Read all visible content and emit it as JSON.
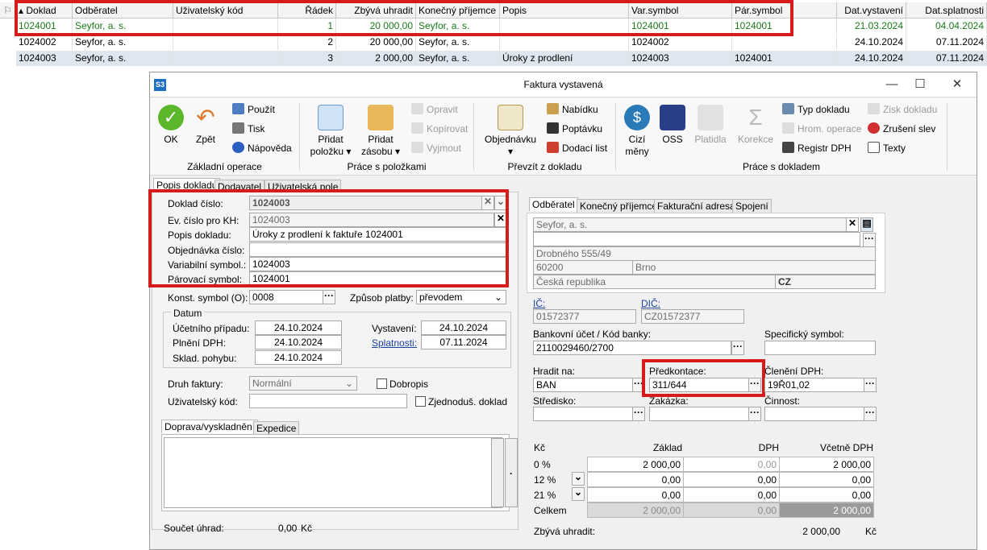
{
  "grid": {
    "columns": [
      "Doklad",
      "Odběratel",
      "Uživatelský kód",
      "Řádek",
      "Zbývá uhradit",
      "Konečný příjemce",
      "Popis",
      "Var.symbol",
      "Pár.symbol",
      "Dat.vystavení",
      "Dat.splatnosti"
    ],
    "rows": [
      {
        "doklad": "1024001",
        "odberatel": "Seyfor, a. s.",
        "kod": "",
        "radek": "1",
        "zbyva": "20 000,00",
        "prijemce": "Seyfor, a. s.",
        "popis": "",
        "var": "1024001",
        "par": "1024001",
        "vyst": "21.03.2024",
        "splat": "04.04.2024"
      },
      {
        "doklad": "1024002",
        "odberatel": "Seyfor, a. s.",
        "kod": "",
        "radek": "2",
        "zbyva": "20 000,00",
        "prijemce": "Seyfor, a. s.",
        "popis": "",
        "var": "1024002",
        "par": "",
        "vyst": "24.10.2024",
        "splat": "07.11.2024"
      },
      {
        "doklad": "1024003",
        "odberatel": "Seyfor, a. s.",
        "kod": "",
        "radek": "3",
        "zbyva": "2 000,00",
        "prijemce": "Seyfor, a. s.",
        "popis": "Úroky z prodlení",
        "var": "1024003",
        "par": "1024001",
        "vyst": "24.10.2024",
        "splat": "07.11.2024"
      }
    ]
  },
  "window": {
    "app_icon": "S3",
    "title": "Faktura vystavená",
    "minimize": "—",
    "maximize": "☐",
    "close": "✕"
  },
  "ribbon": {
    "ok": "OK",
    "zpet": "Zpět",
    "pouzit": "Použít",
    "tisk": "Tisk",
    "napoveda": "Nápověda",
    "grp_zakladni": "Základní operace",
    "pridat_polozku_1": "Přidat",
    "pridat_polozku_2": "položku ▾",
    "pridat_zasobu_1": "Přidat",
    "pridat_zasobu_2": "zásobu ▾",
    "opravit": "Opravit",
    "kopirovat": "Kopírovat",
    "vyjmout": "Vyjmout",
    "grp_polozky": "Práce s položkami",
    "objednavku_1": "Objednávku",
    "objednavku_2": "▾",
    "nabidku": "Nabídku",
    "poptavku": "Poptávku",
    "dodaci_list": "Dodací list",
    "grp_prevzit": "Převzít z dokladu",
    "cizi_meny_1": "Cizí",
    "cizi_meny_2": "měny",
    "oss": "OSS",
    "platidla": "Platidla",
    "korekce": "Korekce",
    "typ_dokladu": "Typ dokladu",
    "hrom_operace": "Hrom. operace",
    "registr_dph": "Registr DPH",
    "zisk_dokladu": "Zisk dokladu",
    "zruseni_slev": "Zrušení slev",
    "texty": "Texty",
    "grp_prace": "Práce s dokladem"
  },
  "tabs_left": [
    "Popis dokladu",
    "Dodavatel",
    "Uživatelská pole"
  ],
  "tabs_right": [
    "Odběratel",
    "Konečný příjemce",
    "Fakturační adresa",
    "Spojení"
  ],
  "form": {
    "doklad_cislo_lbl": "Doklad číslo:",
    "doklad_cislo": "1024003",
    "ev_cislo_lbl": "Ev. číslo pro KH:",
    "ev_cislo": "1024003",
    "popis_lbl": "Popis dokladu:",
    "popis": "Úroky z prodlení k faktuře 1024001",
    "objednavka_lbl": "Objednávka číslo:",
    "objednavka": "",
    "var_lbl": "Variabilní symbol.:",
    "var": "1024003",
    "par_lbl": "Párovací symbol:",
    "par": "1024001",
    "konst_lbl": "Konst. symbol (O):",
    "konst": "0008",
    "zpusob_lbl": "Způsob platby:",
    "zpusob": "převodem",
    "datum_lbl": "Datum",
    "ucetniho_lbl": "Účetního případu:",
    "ucetniho": "24.10.2024",
    "plneni_lbl": "Plnění DPH:",
    "plneni": "24.10.2024",
    "sklad_lbl": "Sklad. pohybu:",
    "sklad": "24.10.2024",
    "vystaveni_lbl": "Vystavení:",
    "vystaveni": "24.10.2024",
    "splatnost_lbl": "Splatnosti:",
    "splatnost": "07.11.2024",
    "druh_lbl": "Druh faktury:",
    "druh": "Normální",
    "dobropis": "Dobropis",
    "uziv_kod_lbl": "Uživatelský kód:",
    "zjednodus": "Zjednoduš. doklad",
    "doprava_tab": "Doprava/vyskladnění",
    "expedice_tab": "Expedice",
    "soucet_lbl": "Součet úhrad:",
    "soucet": "0,00",
    "soucet_mena": "Kč"
  },
  "odberatel": {
    "name": "Seyfor, a. s.",
    "street": "Drobného 555/49",
    "psc": "60200",
    "city": "Brno",
    "country": "Česká republika",
    "country_code": "CZ",
    "ic_lbl": "IČ:",
    "ic": "01572377",
    "dic_lbl": "DIČ:",
    "dic": "CZ01572377",
    "banka_lbl": "Bankovní účet / Kód banky:",
    "banka": "2110029460/2700",
    "spec_lbl": "Specifický symbol:",
    "spec": "",
    "hradit_lbl": "Hradit na:",
    "hradit": "BAN",
    "predkontace_lbl": "Předkontace:",
    "predkontace": "311/644",
    "cleneni_lbl": "Členění DPH:",
    "cleneni": "19Ř01,02",
    "stredisko_lbl": "Středisko:",
    "zakazka_lbl": "Zakázka:",
    "cinnost_lbl": "Činnost:"
  },
  "vat": {
    "h_kc": "Kč",
    "h_zaklad": "Základ",
    "h_dph": "DPH",
    "h_vcetne": "Včetně DPH",
    "rows": [
      {
        "rate": "0 %",
        "zaklad": "2 000,00",
        "dph": "0,00",
        "vcetne": "2 000,00"
      },
      {
        "rate": "12 %",
        "zaklad": "0,00",
        "dph": "0,00",
        "vcetne": "0,00"
      },
      {
        "rate": "21 %",
        "zaklad": "0,00",
        "dph": "0,00",
        "vcetne": "0,00"
      }
    ],
    "celkem_lbl": "Celkem",
    "celkem_zaklad": "2 000,00",
    "celkem_dph": "0,00",
    "celkem_vcetne": "2 000,00",
    "zbyva_lbl": "Zbývá uhradit:",
    "zbyva": "2 000,00",
    "zbyva_mena": "Kč"
  },
  "colors": {
    "highlight": "#d81a1a",
    "selected_row": "#dfe6ef",
    "green_text": "#1a7a1a"
  }
}
